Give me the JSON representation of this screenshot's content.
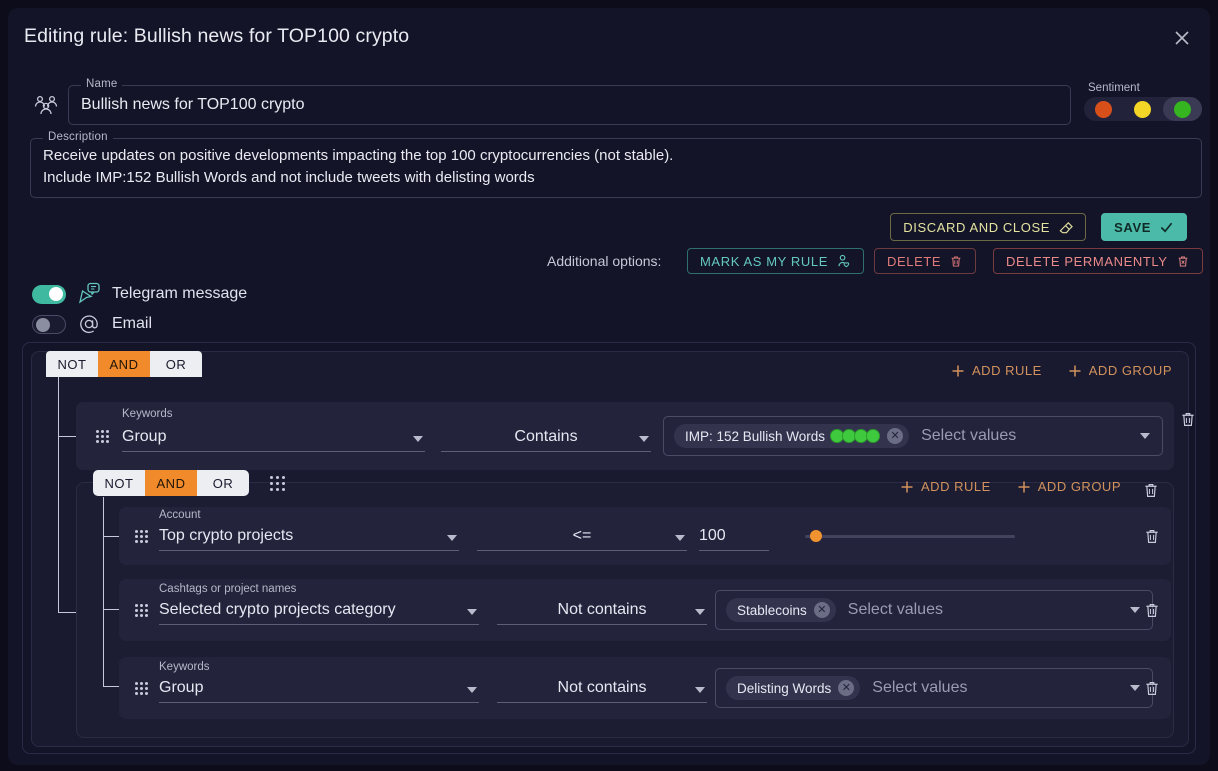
{
  "header": {
    "title": "Editing rule: Bullish news for TOP100 crypto",
    "close_icon": "close-icon"
  },
  "name_field": {
    "legend": "Name",
    "value": "Bullish news for TOP100 crypto",
    "icon": "people-group-icon"
  },
  "description_field": {
    "legend": "Description",
    "value": "Receive updates on positive developments impacting the top 100 cryptocurrencies (not stable).\nInclude IMP:152 Bullish Words and not include tweets with delisting words"
  },
  "sentiment": {
    "label": "Sentiment",
    "options": [
      {
        "name": "negative",
        "color": "#d94f1a",
        "active": false
      },
      {
        "name": "neutral",
        "color": "#f5d526",
        "active": false
      },
      {
        "name": "positive",
        "color": "#35b520",
        "active": true
      }
    ]
  },
  "actions": {
    "discard_label": "DISCARD AND CLOSE",
    "save_label": "SAVE",
    "additional_options_label": "Additional options:",
    "mark_label": "MARK AS MY RULE",
    "delete_label": "DELETE",
    "delete_permanently_label": "DELETE PERMANENTLY"
  },
  "channels": [
    {
      "label": "Telegram message",
      "icon": "telegram-cursor-chat-icon",
      "enabled": true
    },
    {
      "label": "Email",
      "icon": "at-sign-icon",
      "enabled": false
    }
  ],
  "builder": {
    "root_group": {
      "operators": [
        "NOT",
        "AND",
        "OR"
      ],
      "active_operator": "AND",
      "add_rule_label": "ADD RULE",
      "add_group_label": "ADD GROUP",
      "rules": [
        {
          "field_label": "Keywords",
          "field_value": "Group",
          "operator": "Contains",
          "values_placeholder": "Select values",
          "chips": [
            {
              "label": "IMP: 152 Bullish Words",
              "dots": 4,
              "dot_color": "#3fc93f"
            }
          ]
        }
      ]
    },
    "nested_group": {
      "operators": [
        "NOT",
        "AND",
        "OR"
      ],
      "active_operator": "AND",
      "add_rule_label": "ADD RULE",
      "add_group_label": "ADD GROUP",
      "rules": [
        {
          "field_label": "Account",
          "field_value": "Top crypto projects",
          "operator": "<=",
          "number_value": "100",
          "slider_percent": 5
        },
        {
          "field_label": "Cashtags or project names",
          "field_value": "Selected crypto projects category",
          "operator": "Not contains",
          "values_placeholder": "Select values",
          "chips": [
            {
              "label": "Stablecoins",
              "dots": 0
            }
          ]
        },
        {
          "field_label": "Keywords",
          "field_value": "Group",
          "operator": "Not contains",
          "values_placeholder": "Select values",
          "chips": [
            {
              "label": "Delisting Words",
              "dots": 0
            }
          ]
        }
      ]
    }
  },
  "colors": {
    "accent_orange": "#f08a2a",
    "accent_teal": "#4cbaa8",
    "danger_red": "#e07b7b",
    "add_action": "#d2925c",
    "panel_bg": "#191930",
    "rule_bg": "#23233c"
  }
}
